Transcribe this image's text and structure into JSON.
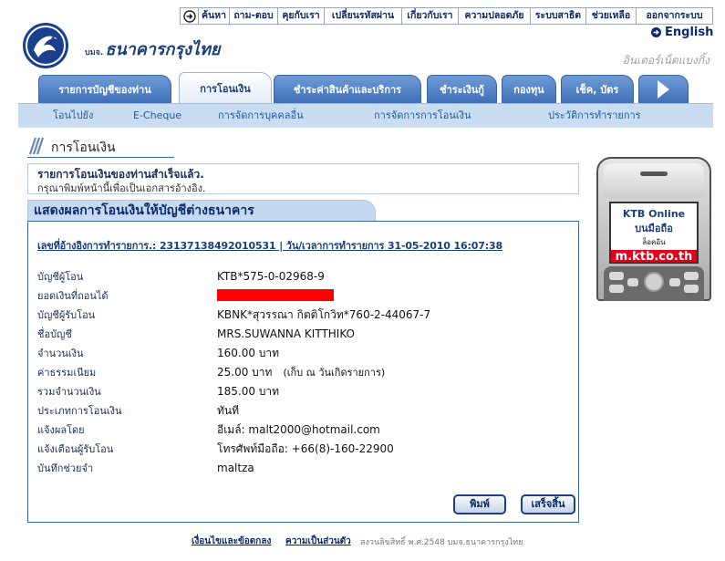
{
  "top_nav": {
    "icon": "arrow-circle-icon",
    "items": [
      "ค้นหา",
      "ถาม-ตอบ",
      "คุยกับเรา",
      "เปลี่ยนรหัสผ่าน",
      "เกี่ยวกับเรา",
      "ความปลอดภัย",
      "ระบบสาธิต",
      "ช่วยเหลือ",
      "ออกจากระบบ"
    ]
  },
  "language": {
    "label": "English",
    "icon": "arrow-circle-icon"
  },
  "brand": {
    "logo_icon": "ktb-logo",
    "prefix": "บมจ.",
    "name": "ธนาคารกรุงไทย",
    "tagline": "อินเตอร์เน็ตแบงกิ้ง"
  },
  "tabs": [
    {
      "label": "รายการบัญชีของท่าน",
      "active": false
    },
    {
      "label": "การโอนเงิน",
      "active": true
    },
    {
      "label": "ชำระค่าสินค้าและบริการ",
      "active": false
    },
    {
      "label": "ชำระเงินกู้",
      "active": false
    },
    {
      "label": "กองทุน",
      "active": false
    },
    {
      "label": "เช็ค, บัตร",
      "active": false
    }
  ],
  "tabs_more_icon": "right-arrow-icon",
  "subnav": [
    "โอนไปยัง",
    "E-Cheque",
    "การจัดการบุคคลอื่น",
    "การจัดการการโอนเงิน",
    "ประวัติการทำรายการ"
  ],
  "section_title": "การโอนเงิน",
  "message": {
    "title": "รายการโอนเงินของท่านสำเร็จแล้ว.",
    "note": "กรุณาพิมพ์หน้านี้เพื่อเป็นเอกสารอ้างอิง."
  },
  "ad": {
    "title": "KTB Online",
    "subtitle": "บนมือถือ",
    "login": "ล็อคอิน",
    "url": "m.ktb.co.th"
  },
  "result": {
    "heading": "แสดงผลการโอนเงินให้บัญชีต่างธนาคาร",
    "reference": {
      "label": "เลขที่อ้างอิงการทำรายการ.:",
      "number": "23137138492010531",
      "separator": "|",
      "datetime_label": "วัน/เวลาการทำรายการ",
      "datetime": "31-05-2010 16:07:38"
    },
    "rows": [
      {
        "label": "บัญชีผู้โอน",
        "value": "KTB*575-0-02968-9"
      },
      {
        "label": "ยอดเงินที่ถอนได้",
        "redacted": true
      },
      {
        "label": "บัญชีผู้รับโอน",
        "value": "KBNK*สุวรรณา กิตติโกวิท*760-2-44067-7"
      },
      {
        "label": "ชื่อบัญชี",
        "value": "MRS.SUWANNA KITTHIKO"
      },
      {
        "label": "จำนวนเงิน",
        "value": "160.00 บาท"
      },
      {
        "label": "ค่าธรรมเนียม",
        "value": "25.00 บาท",
        "note": "(เก็บ ณ วันเกิดรายการ)"
      },
      {
        "label": "รวมจำนวนเงิน",
        "value": "185.00 บาท"
      },
      {
        "label": "ประเภทการโอนเงิน",
        "value": "ทันที"
      },
      {
        "label": "แจ้งผลโดย",
        "value": "อีเมล์: malt2000@hotmail.com"
      },
      {
        "label": "แจ้งเตือนผู้รับโอน",
        "value": "โทรศัพท์มือถือ: +66(8)-160-22900"
      },
      {
        "label": "บันทึกช่วยจำ",
        "value": "maltza"
      }
    ]
  },
  "buttons": {
    "print": "พิมพ์",
    "done": "เสร็จสิ้น"
  },
  "footer": {
    "terms": "เงื่อนไขและข้อตกลง",
    "privacy": "ความเป็นส่วนตัว",
    "copyright": "สงวนลิขสิทธิ์ พ.ศ.2548 บมจ.ธนาคารกรุงไทย"
  },
  "colors": {
    "brand_navy": "#1b3f7a",
    "tab_blue": "#4a7cc0",
    "subnav_bg": "#c9ddf2",
    "redaction": "#ff0000",
    "ad_red": "#e3001b"
  }
}
